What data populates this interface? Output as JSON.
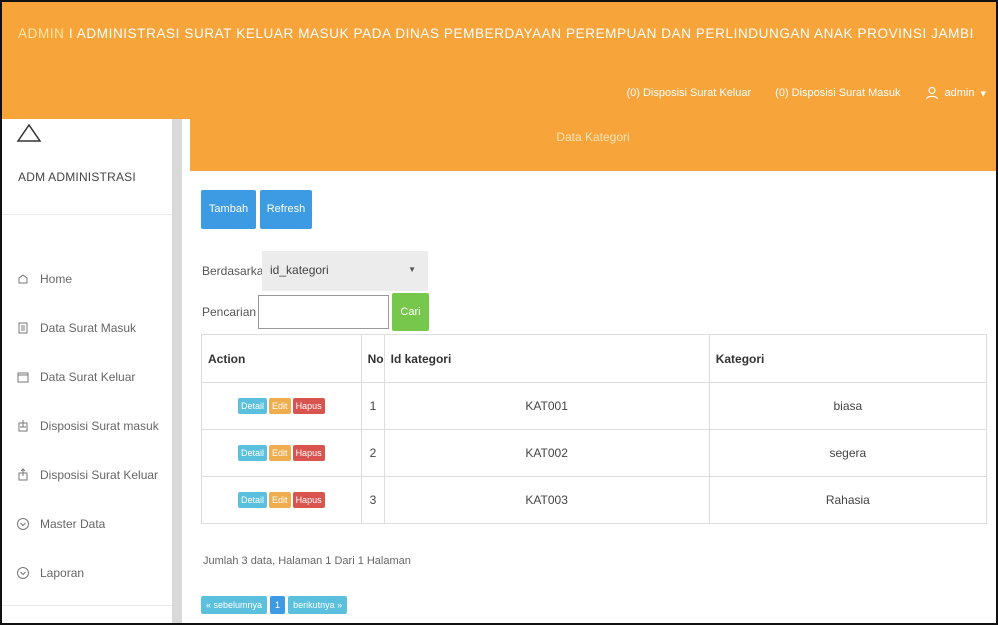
{
  "header": {
    "brand": "ADMIN",
    "title_rest": " I ADMINISTRASI SURAT KELUAR MASUK PADA DINAS PEMBERDAYAAN PEREMPUAN DAN PERLINDUNGAN ANAK PROVINSI JAMBI",
    "nav": {
      "disposisi_keluar": "(0) Disposisi Surat Keluar",
      "disposisi_masuk": "(0) Disposisi Surat Masuk",
      "user": "admin",
      "user_caret": "▾"
    },
    "color": "#f7a43a"
  },
  "sidebar": {
    "brand": "ADM ADMINISTRASI",
    "items": [
      {
        "label": "Home",
        "icon": "home-icon"
      },
      {
        "label": "Data Surat Masuk",
        "icon": "document-icon"
      },
      {
        "label": "Data Surat Keluar",
        "icon": "folder-icon"
      },
      {
        "label": "Disposisi Surat masuk",
        "icon": "inbox-icon"
      },
      {
        "label": "Disposisi Surat Keluar",
        "icon": "outbox-icon"
      },
      {
        "label": "Master Data",
        "icon": "chevron-circle-icon"
      },
      {
        "label": "Laporan",
        "icon": "chevron-circle-icon"
      }
    ]
  },
  "main": {
    "panel_title": "Data Kategori",
    "buttons": {
      "tambah": "Tambah",
      "refresh": "Refresh",
      "cari": "Cari"
    },
    "filter": {
      "by_label": "Berdasarkan:",
      "by_value": "id_kategori",
      "search_label": "Pencarian",
      "search_value": ""
    },
    "table": {
      "headers": [
        "Action",
        "No",
        "Id kategori",
        "Kategori"
      ],
      "action_labels": {
        "detail": "Detail",
        "edit": "Edit",
        "hapus": "Hapus"
      },
      "rows": [
        {
          "no": "1",
          "id": "KAT001",
          "kategori": "biasa"
        },
        {
          "no": "2",
          "id": "KAT002",
          "kategori": "segera"
        },
        {
          "no": "3",
          "id": "KAT003",
          "kategori": "Rahasia"
        }
      ]
    },
    "summary": "Jumlah 3 data, Halaman 1 Dari 1 Halaman",
    "pagination": {
      "prev": "« sebelumnya",
      "page": "1",
      "next": "berikutnya »"
    }
  }
}
